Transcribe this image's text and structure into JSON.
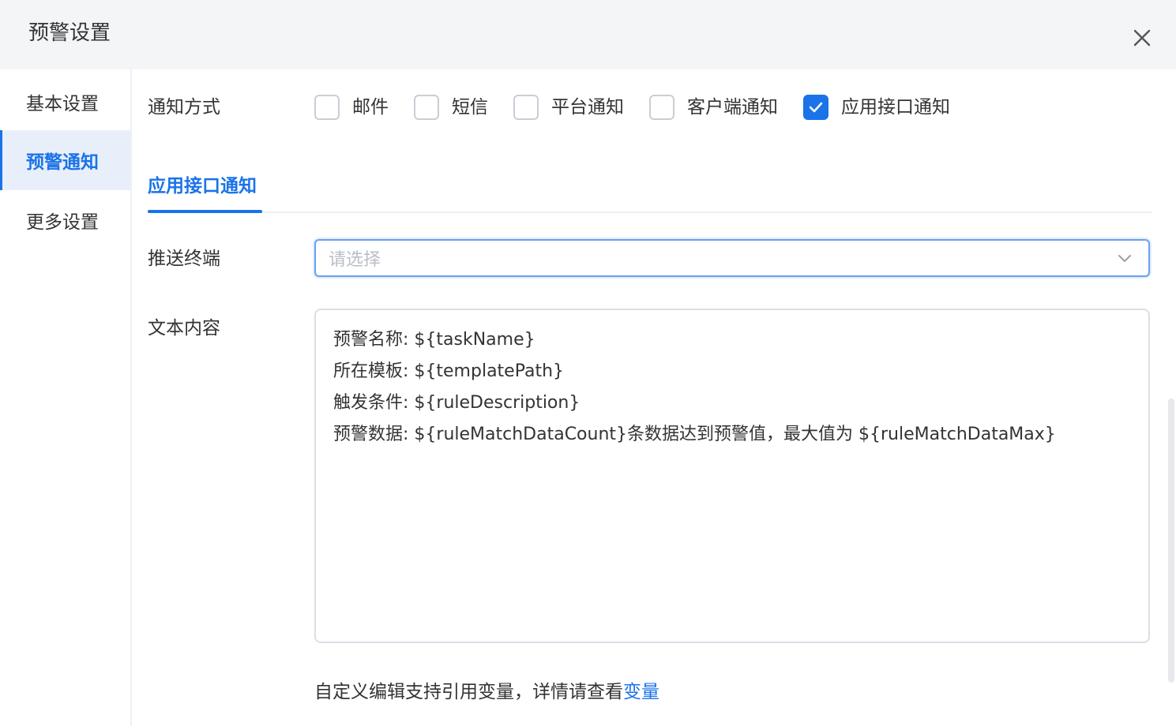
{
  "header": {
    "title": "预警设置"
  },
  "sidebar": {
    "items": [
      {
        "label": "基本设置"
      },
      {
        "label": "预警通知"
      },
      {
        "label": "更多设置"
      }
    ]
  },
  "form": {
    "method_label": "通知方式",
    "methods": [
      {
        "label": "邮件",
        "checked": false
      },
      {
        "label": "短信",
        "checked": false
      },
      {
        "label": "平台通知",
        "checked": false
      },
      {
        "label": "客户端通知",
        "checked": false
      },
      {
        "label": "应用接口通知",
        "checked": true
      }
    ],
    "tab_label": "应用接口通知",
    "terminal_label": "推送终端",
    "terminal_placeholder": "请选择",
    "text_label": "文本内容",
    "text_lines": [
      "预警名称: ${taskName}",
      "所在模板: ${templatePath}",
      "触发条件: ${ruleDescription}",
      "预警数据: ${ruleMatchDataCount}条数据达到预警值，最大值为 ${ruleMatchDataMax}"
    ],
    "hint_prefix": "自定义编辑支持引用变量，详情请查看",
    "hint_link": "变量"
  },
  "colors": {
    "accent": "#1a73e8",
    "header_bg": "#f4f5f7",
    "active_bg": "#e9effa"
  }
}
